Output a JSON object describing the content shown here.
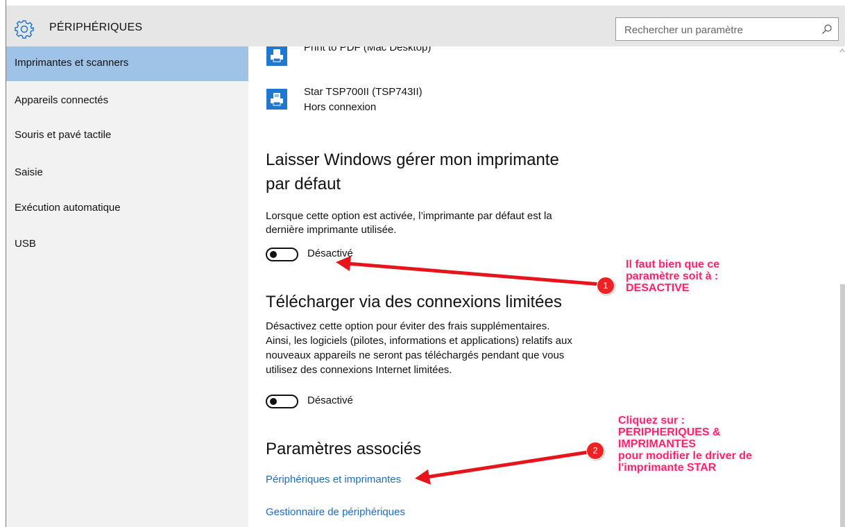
{
  "header": {
    "title": "PÉRIPHÉRIQUES",
    "icon": "gear-icon",
    "search_placeholder": "Rechercher un paramètre"
  },
  "sidebar": {
    "items": [
      {
        "label": "Imprimantes et scanners",
        "selected": true
      },
      {
        "label": "Appareils connectés",
        "selected": false
      },
      {
        "label": "Souris et pavé tactile",
        "selected": false
      },
      {
        "label": "Saisie",
        "selected": false
      },
      {
        "label": "Exécution automatique",
        "selected": false
      },
      {
        "label": "USB",
        "selected": false
      }
    ]
  },
  "printers": [
    {
      "name": "Print to PDF (Mac Desktop)",
      "status": ""
    },
    {
      "name": "Star TSP700II (TSP743II)",
      "status": "Hors connexion"
    }
  ],
  "default_printer": {
    "heading_line1": "Laisser Windows gérer mon imprimante",
    "heading_line2": "par défaut",
    "description_line1": "Lorsque cette option est activée, l’imprimante par défaut est la",
    "description_line2": "dernière imprimante utilisée.",
    "toggle_state": "Désactivé"
  },
  "metered": {
    "heading": "Télécharger via des connexions limitées",
    "description_lines": [
      "Désactivez cette option pour éviter des frais supplémentaires.",
      "Ainsi, les logiciels (pilotes, informations et applications) relatifs aux",
      "nouveaux appareils ne seront pas téléchargés pendant que vous",
      "utilisez des connexions Internet limitées."
    ],
    "toggle_state": "Désactivé"
  },
  "related": {
    "heading": "Paramètres associés",
    "links": [
      "Périphériques et imprimantes",
      "Gestionnaire de périphériques"
    ]
  },
  "annotations": [
    {
      "number": "1",
      "lines": [
        "Il faut bien que ce",
        "paramètre soit à :",
        "DESACTIVE"
      ]
    },
    {
      "number": "2",
      "lines": [
        "Cliquez sur :",
        "PERIPHERIQUES &",
        "IMPRIMANTES",
        "pour modifier le driver de",
        "l'imprimante STAR"
      ]
    }
  ],
  "colors": {
    "accent": "#1e77d0",
    "selected_nav": "#9fc3e6",
    "link": "#1a6ec4",
    "annotation_text": "#ff1f6e",
    "annotation_arrow": "#e8141b"
  }
}
